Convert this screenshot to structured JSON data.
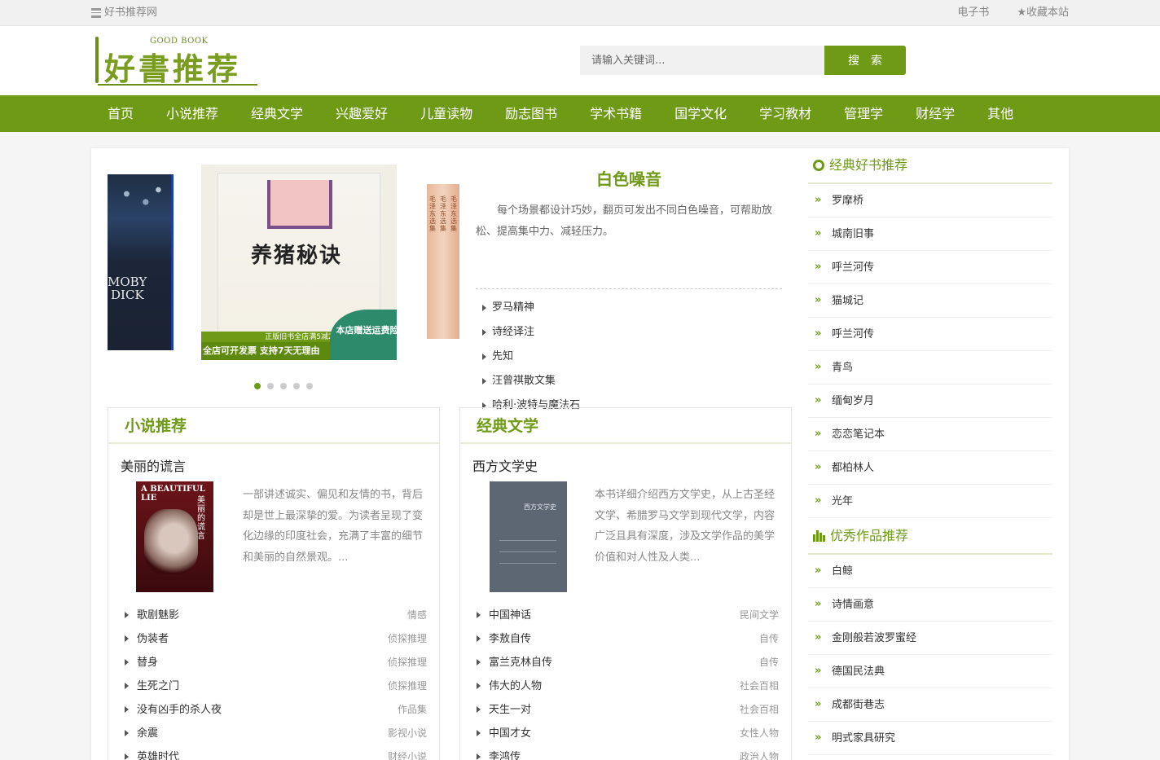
{
  "topbar": {
    "site_name": "好书推荐网",
    "links": [
      "电子书",
      "收藏本站"
    ]
  },
  "logo": {
    "en": "GOOD BOOK",
    "cn": "好書推荐"
  },
  "search": {
    "placeholder": "请输入关键词...",
    "button": "搜索"
  },
  "nav": [
    "首页",
    "小说推荐",
    "经典文学",
    "兴趣爱好",
    "儿童读物",
    "励志图书",
    "学术书籍",
    "国学文化",
    "学习教材",
    "管理学",
    "财经学",
    "其他"
  ],
  "slider": {
    "left_cover_text": [
      "MOBY",
      "DICK"
    ],
    "center_cover_title": "养猪秘诀",
    "center_band_top": "正版旧书全店满5减2",
    "center_band_bottom": "全店可开发票 支持7天无理由",
    "center_badge": "本店赠送运费险",
    "dots": 5,
    "active_dot": 0
  },
  "feature": {
    "title": "白色噪音",
    "desc": "每个场景都设计巧妙，翻页可发出不同白色噪音，可帮助放松、提高集中力、减轻压力。",
    "items": [
      "罗马精神",
      "诗经译注",
      "先知",
      "汪曾祺散文集",
      "哈利·波特与魔法石"
    ]
  },
  "box_novel": {
    "header": "小说推荐",
    "book_title": "美丽的谎言",
    "cover_text": "A BEAUTIFUL LIE",
    "cover_vertical": "美丽的谎言",
    "desc": "一部讲述诚实、偏见和友情的书，背后却是世上最深挚的爱。为读者呈现了变化边缘的印度社会，充满了丰富的细节和美丽的自然景观。...",
    "items": [
      {
        "name": "歌剧魅影",
        "tag": "情感"
      },
      {
        "name": "伪装者",
        "tag": "侦探推理"
      },
      {
        "name": "替身",
        "tag": "侦探推理"
      },
      {
        "name": "生死之门",
        "tag": "侦探推理"
      },
      {
        "name": "没有凶手的杀人夜",
        "tag": "作品集"
      },
      {
        "name": "余震",
        "tag": "影视小说"
      },
      {
        "name": "英雄时代",
        "tag": "财经小说"
      }
    ]
  },
  "box_classic": {
    "header": "经典文学",
    "book_title": "西方文学史",
    "cover_text": "西方文学史",
    "desc": "本书详细介绍西方文学史，从上古圣经文学、希腊罗马文学到现代文学，内容广泛且具有深度，涉及文学作品的美学价值和对人性及人类...",
    "items": [
      {
        "name": "中国神话",
        "tag": "民间文学"
      },
      {
        "name": "李敖自传",
        "tag": "自传"
      },
      {
        "name": "富兰克林自传",
        "tag": "自传"
      },
      {
        "name": "伟大的人物",
        "tag": "社会百相"
      },
      {
        "name": "天生一对",
        "tag": "社会百相"
      },
      {
        "name": "中国才女",
        "tag": "女性人物"
      },
      {
        "name": "李鸿传",
        "tag": "政治人物"
      }
    ]
  },
  "sidebar": {
    "section1_title": "经典好书推荐",
    "section1_items": [
      "罗摩桥",
      "城南旧事",
      "呼兰河传",
      "猫城记",
      "呼兰河传",
      "青鸟",
      "缅甸岁月",
      "恋恋笔记本",
      "都柏林人",
      "光年"
    ],
    "section2_title": "优秀作品推荐",
    "section2_items": [
      "白鲸",
      "诗情画意",
      "金刚般若波罗蜜经",
      "德国民法典",
      "成都街巷志",
      "明式家具研究"
    ]
  },
  "colors": {
    "accent": "#6f9a16",
    "nav_bg": "#6f9a16"
  }
}
